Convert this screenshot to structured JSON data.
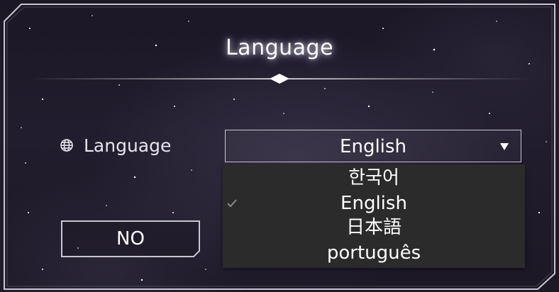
{
  "dialog": {
    "title": "Language"
  },
  "setting": {
    "label": "Language",
    "icon": "globe-icon"
  },
  "select": {
    "value": "English",
    "caret_icon": "caret-down-icon"
  },
  "dropdown": {
    "selected": "English",
    "options": [
      "한국어",
      "English",
      "日本語",
      "português"
    ]
  },
  "buttons": {
    "no": "NO"
  },
  "colors": {
    "accent": "#ffffff",
    "dropdown_bg": "#2b2b2b",
    "frame": "#c9c6cf"
  }
}
